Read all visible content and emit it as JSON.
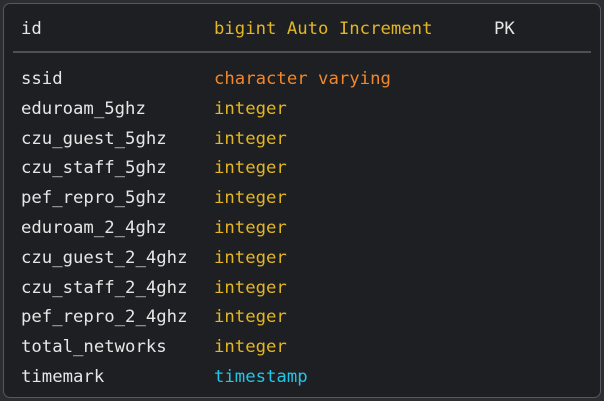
{
  "colors": {
    "background": "#1e1f22",
    "border": "#55585e",
    "text": "#e6e6e6",
    "integer": "#e3b623",
    "character_varying": "#f0872d",
    "timestamp": "#20c5e8"
  },
  "primary_key": {
    "name": "id",
    "type": "bigint Auto Increment",
    "key": "PK"
  },
  "columns": [
    {
      "name": "ssid",
      "type": "character varying"
    },
    {
      "name": "eduroam_5ghz",
      "type": "integer"
    },
    {
      "name": "czu_guest_5ghz",
      "type": "integer"
    },
    {
      "name": "czu_staff_5ghz",
      "type": "integer"
    },
    {
      "name": "pef_repro_5ghz",
      "type": "integer"
    },
    {
      "name": "eduroam_2_4ghz",
      "type": "integer"
    },
    {
      "name": "czu_guest_2_4ghz",
      "type": "integer"
    },
    {
      "name": "czu_staff_2_4ghz",
      "type": "integer"
    },
    {
      "name": "pef_repro_2_4ghz",
      "type": "integer"
    },
    {
      "name": "total_networks",
      "type": "integer"
    },
    {
      "name": "timemark",
      "type": "timestamp"
    }
  ]
}
